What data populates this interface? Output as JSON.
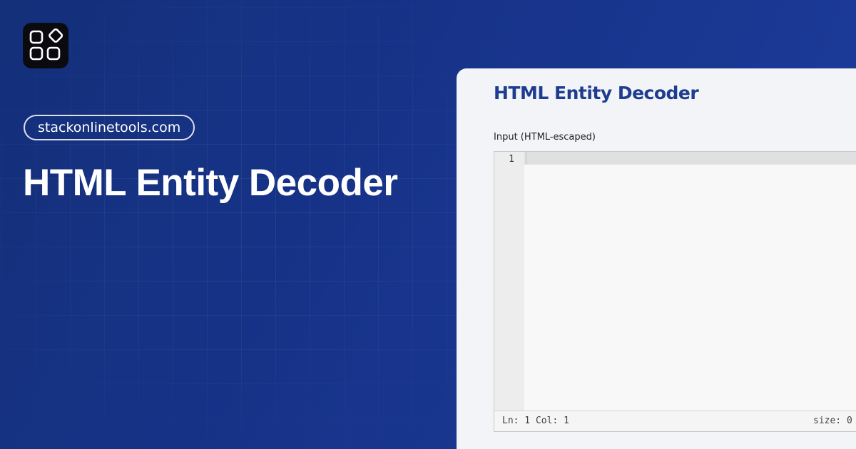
{
  "brand": {
    "logo_icon": "app-grid-icon",
    "domain": "stackonlinetools.com"
  },
  "hero": {
    "title": "HTML Entity Decoder"
  },
  "tool": {
    "title": "HTML Entity Decoder",
    "input_label": "Input (HTML-escaped)",
    "editor": {
      "line_number": "1",
      "content": "",
      "status_position": "Ln: 1 Col: 1",
      "status_size": "size: 0"
    }
  },
  "colors": {
    "background": "#17338a",
    "panel": "#f3f4f7",
    "panel_title": "#1f3d8f",
    "logo_bg": "#0b0b0f"
  }
}
